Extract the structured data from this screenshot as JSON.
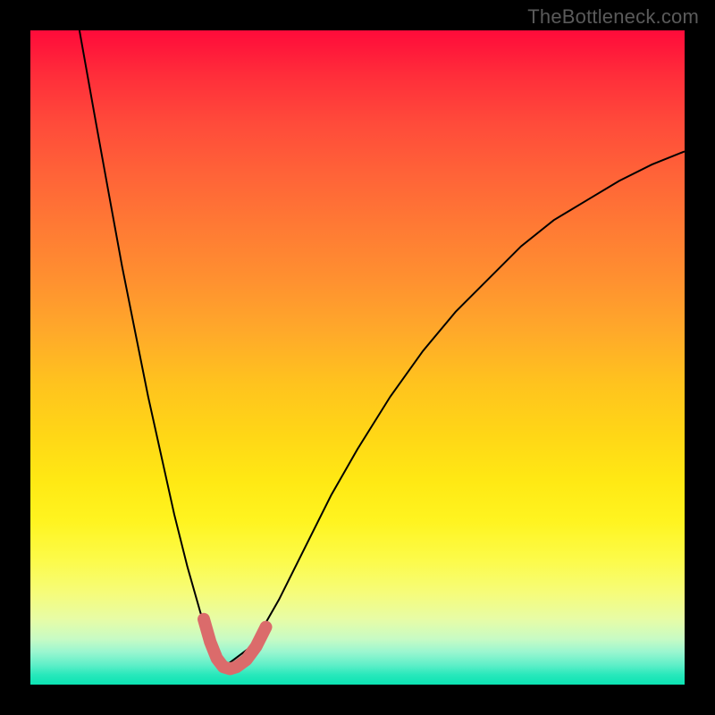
{
  "watermark": "TheBottleneck.com",
  "chart_data": {
    "type": "line",
    "title": "",
    "xlabel": "",
    "ylabel": "",
    "xlim": [
      0,
      100
    ],
    "ylim": [
      0,
      100
    ],
    "grid": false,
    "legend": false,
    "background_gradient": {
      "stops": [
        {
          "pos": 0.0,
          "color": "#ff0b3a"
        },
        {
          "pos": 0.3,
          "color": "#ff7a34"
        },
        {
          "pos": 0.62,
          "color": "#ffd716"
        },
        {
          "pos": 0.86,
          "color": "#f6fc7a"
        },
        {
          "pos": 1.0,
          "color": "#0be3b3"
        }
      ]
    },
    "series": [
      {
        "name": "bottleneck-curve",
        "stroke": "#000000",
        "stroke_width": 2,
        "x": [
          7.5,
          10,
          12,
          14,
          16,
          18,
          20,
          22,
          24,
          26,
          28,
          30,
          34,
          38,
          42,
          46,
          50,
          55,
          60,
          65,
          70,
          75,
          80,
          85,
          90,
          95,
          100
        ],
        "y": [
          100,
          86,
          75,
          64,
          54,
          44,
          35,
          26,
          18,
          11,
          6,
          3,
          6,
          13,
          21,
          29,
          36,
          44,
          51,
          57,
          62,
          67,
          71,
          74,
          77,
          79.5,
          81.5
        ]
      },
      {
        "name": "min-marker",
        "stroke": "#db6b6b",
        "stroke_width": 14,
        "linecap": "round",
        "x": [
          26.5,
          27.5,
          28.5,
          29.5,
          30.5,
          31.5,
          33,
          34.5,
          36
        ],
        "y": [
          10,
          6.5,
          4,
          2.7,
          2.4,
          2.7,
          3.8,
          5.8,
          8.8
        ]
      }
    ]
  }
}
